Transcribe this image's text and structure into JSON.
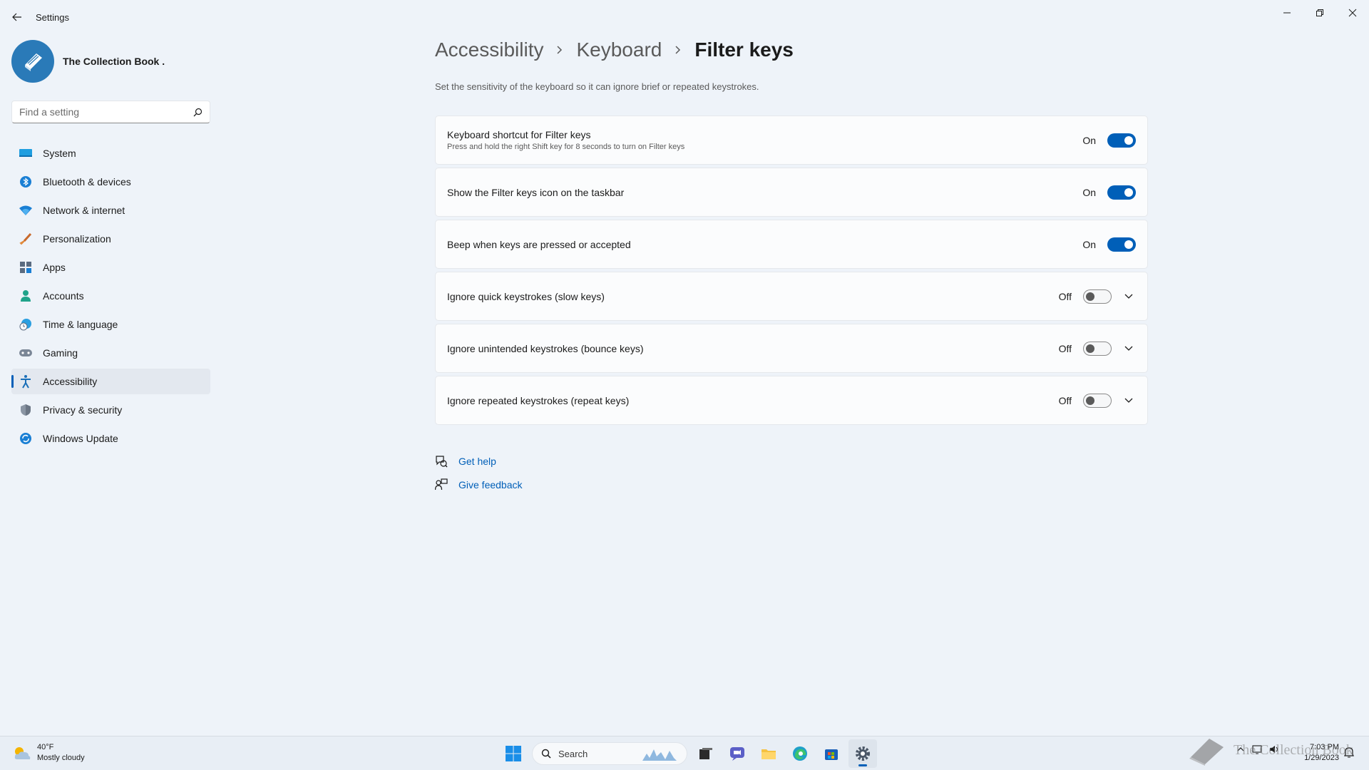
{
  "window": {
    "title": "Settings"
  },
  "profile": {
    "name": "The Collection Book ."
  },
  "search": {
    "placeholder": "Find a setting"
  },
  "sidebar": {
    "items": [
      {
        "label": "System",
        "icon": "display-icon"
      },
      {
        "label": "Bluetooth & devices",
        "icon": "bluetooth-icon"
      },
      {
        "label": "Network & internet",
        "icon": "wifi-icon"
      },
      {
        "label": "Personalization",
        "icon": "brush-icon"
      },
      {
        "label": "Apps",
        "icon": "apps-icon"
      },
      {
        "label": "Accounts",
        "icon": "person-icon"
      },
      {
        "label": "Time & language",
        "icon": "clock-globe-icon"
      },
      {
        "label": "Gaming",
        "icon": "gamepad-icon"
      },
      {
        "label": "Accessibility",
        "icon": "accessibility-icon",
        "active": true
      },
      {
        "label": "Privacy & security",
        "icon": "shield-icon"
      },
      {
        "label": "Windows Update",
        "icon": "update-icon"
      }
    ]
  },
  "breadcrumb": {
    "level1": "Accessibility",
    "level2": "Keyboard",
    "current": "Filter keys"
  },
  "page": {
    "description": "Set the sensitivity of the keyboard so it can ignore brief or repeated keystrokes."
  },
  "settings": [
    {
      "title": "Keyboard shortcut for Filter keys",
      "subtitle": "Press and hold the right Shift key for 8 seconds to turn on Filter keys",
      "state": "On",
      "expandable": false
    },
    {
      "title": "Show the Filter keys icon on the taskbar",
      "subtitle": "",
      "state": "On",
      "expandable": false
    },
    {
      "title": "Beep when keys are pressed or accepted",
      "subtitle": "",
      "state": "On",
      "expandable": false
    },
    {
      "title": "Ignore quick keystrokes (slow keys)",
      "subtitle": "",
      "state": "Off",
      "expandable": true
    },
    {
      "title": "Ignore unintended keystrokes (bounce keys)",
      "subtitle": "",
      "state": "Off",
      "expandable": true
    },
    {
      "title": "Ignore repeated keystrokes (repeat keys)",
      "subtitle": "",
      "state": "Off",
      "expandable": true
    }
  ],
  "links": {
    "help": "Get help",
    "feedback": "Give feedback"
  },
  "taskbar": {
    "weather_temp": "40°F",
    "weather_desc": "Mostly cloudy",
    "search_label": "Search",
    "time": "7:03 PM",
    "date": "1/29/2023"
  },
  "watermark": {
    "text": "The Collection Book"
  },
  "colors": {
    "accent": "#005fb8",
    "background": "#eef3f9",
    "card": "#fbfcfd"
  }
}
